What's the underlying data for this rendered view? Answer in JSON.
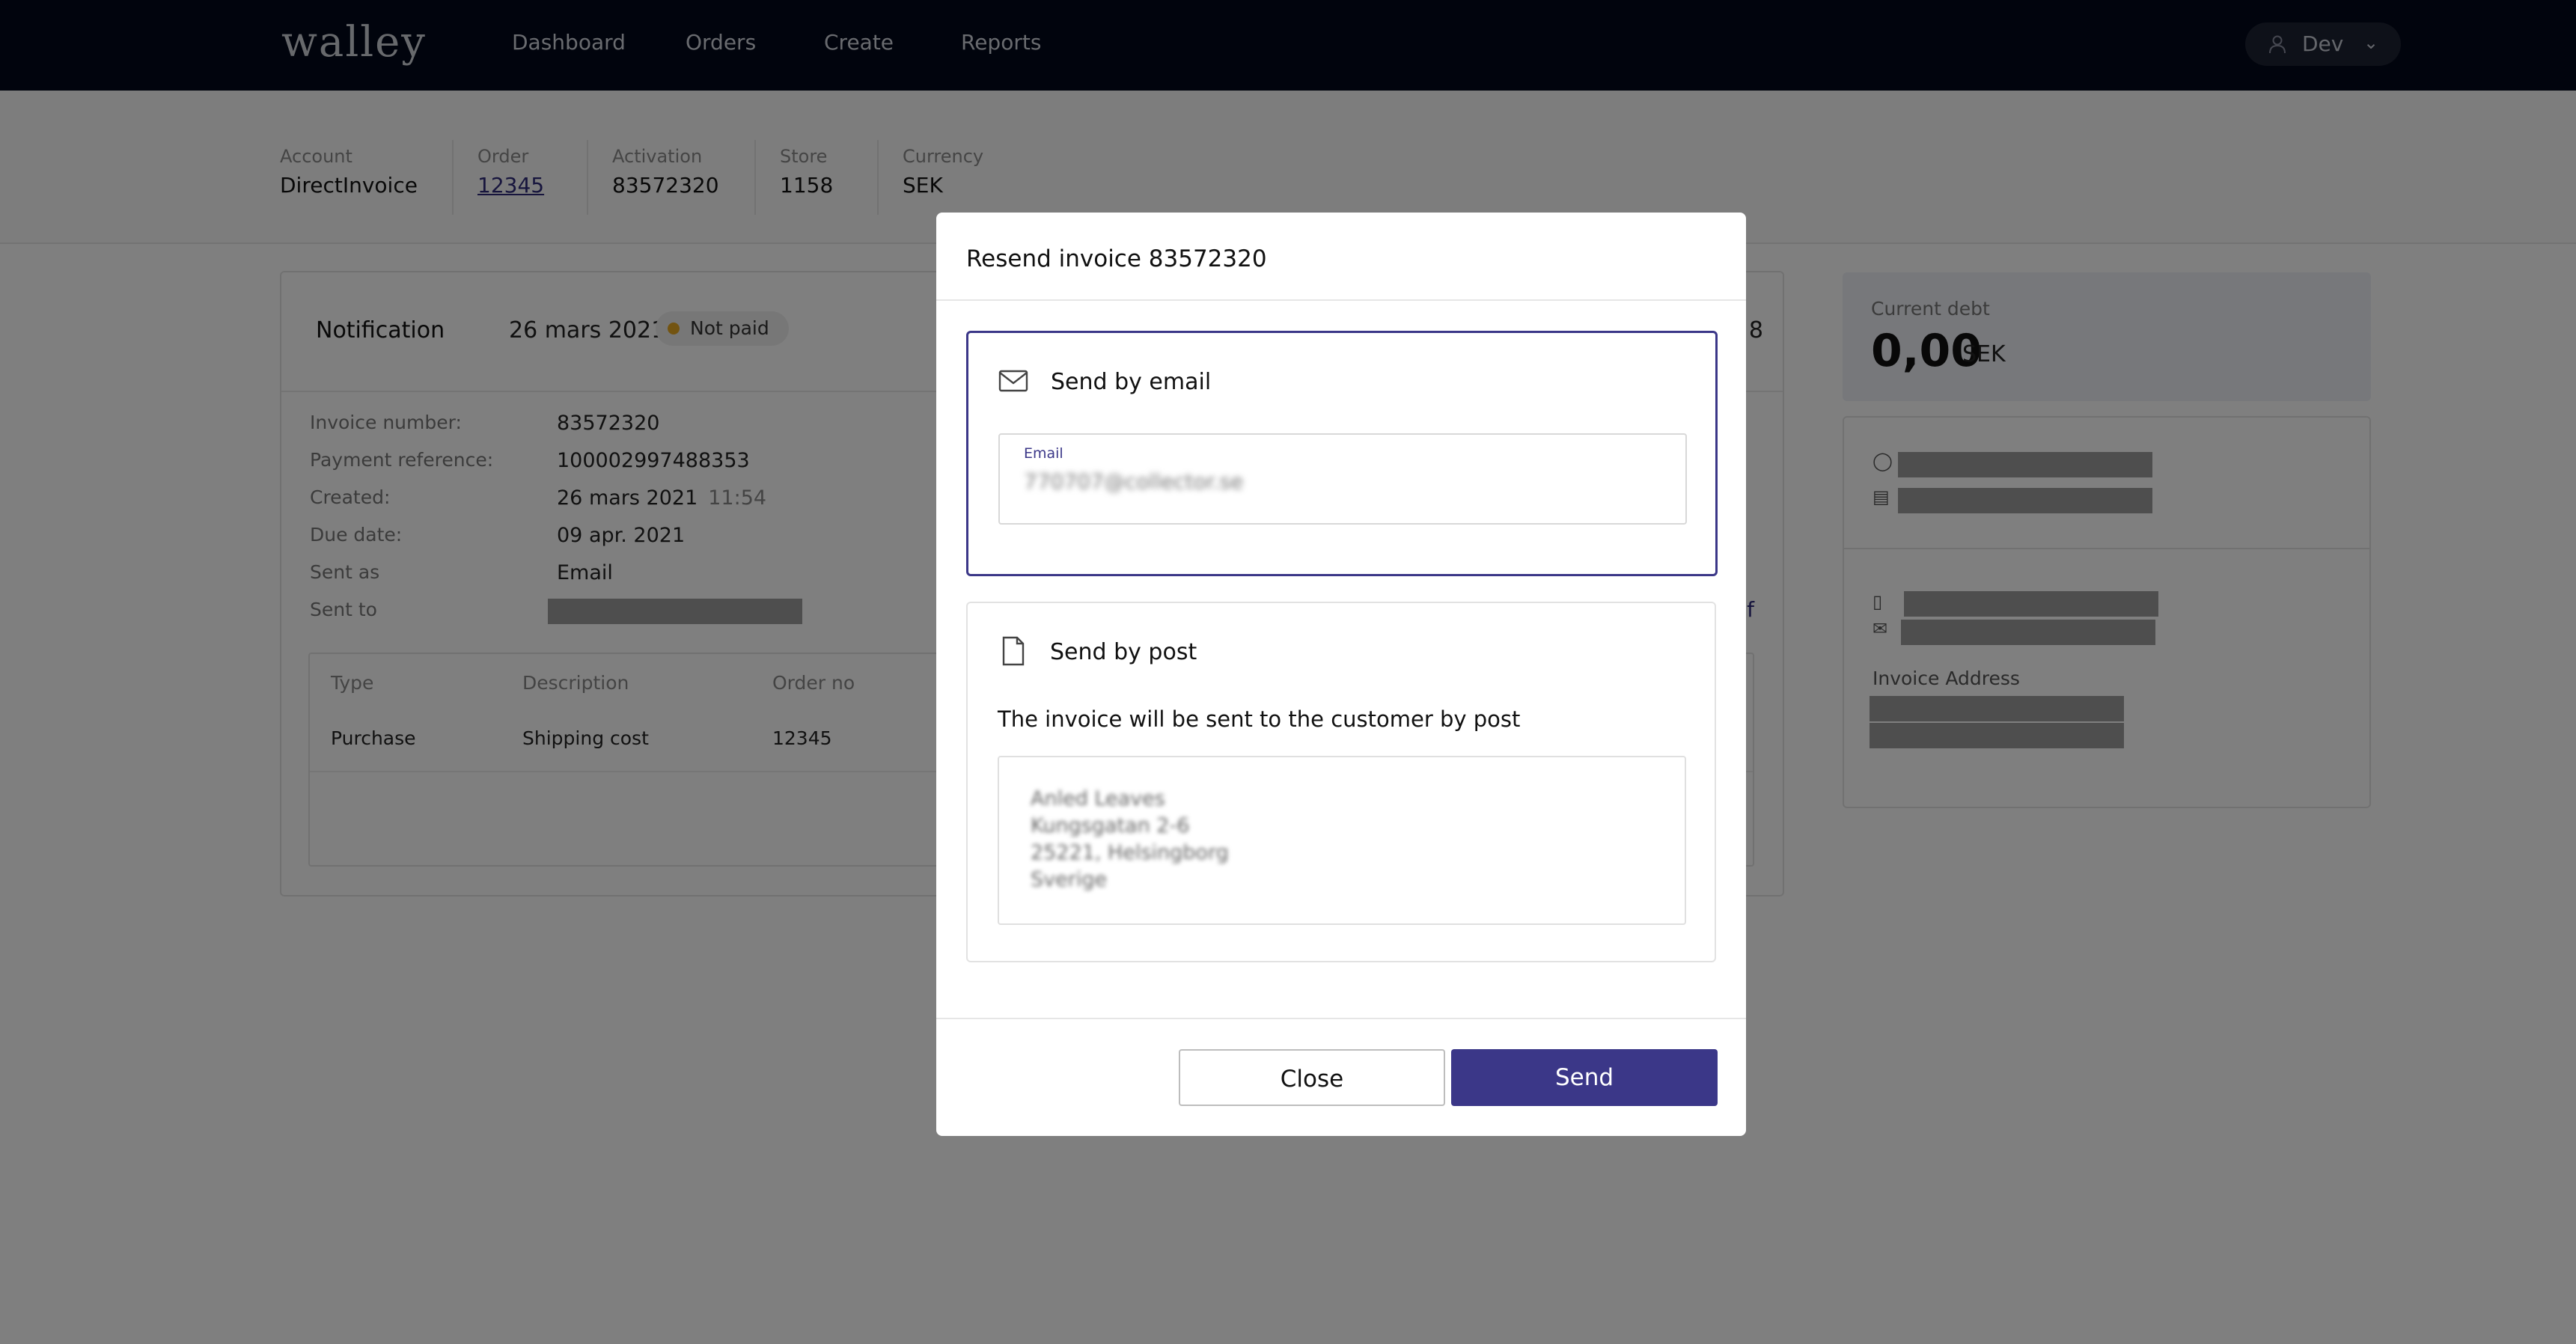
{
  "nav": {
    "logo": "walley",
    "links": [
      "Dashboard",
      "Orders",
      "Create",
      "Reports"
    ],
    "user": "Dev"
  },
  "summary": {
    "account": {
      "label": "Account",
      "value": "DirectInvoice"
    },
    "order": {
      "label": "Order",
      "value": "12345"
    },
    "activation": {
      "label": "Activation",
      "value": "83572320"
    },
    "store": {
      "label": "Store",
      "value": "1158"
    },
    "currency": {
      "label": "Currency",
      "value": "SEK"
    }
  },
  "notification": {
    "title": "Notification",
    "date": "26 mars 2021",
    "status": "Not paid",
    "partial_number": "8",
    "partial_link": "f",
    "details": {
      "invoice_number_label": "Invoice number:",
      "invoice_number": "83572320",
      "payment_reference_label": "Payment reference:",
      "payment_reference": "100002997488353",
      "created_label": "Created:",
      "created_date": "26 mars 2021",
      "created_time": "11:54",
      "due_date_label": "Due date:",
      "due_date": "09 apr. 2021",
      "sent_as_label": "Sent as",
      "sent_as": "Email",
      "sent_to_label": "Sent to"
    },
    "table": {
      "headers": [
        "Type",
        "Description",
        "Order no"
      ],
      "rows": [
        [
          "Purchase",
          "Shipping cost",
          "12345"
        ]
      ]
    }
  },
  "debt": {
    "label": "Current debt",
    "value": "0,00",
    "currency": "SEK"
  },
  "side": {
    "invoice_address_label": "Invoice Address"
  },
  "modal": {
    "title": "Resend invoice 83572320",
    "email_option": {
      "title": "Send by email",
      "field_label": "Email",
      "field_value": "770707@collector.se"
    },
    "post_option": {
      "title": "Send by post",
      "description": "The invoice will be sent to the customer by post",
      "address_lines": [
        "Anled Leaves",
        "Kungsgatan 2-6",
        "25221, Helsingborg",
        "Sverige"
      ]
    },
    "close_label": "Close",
    "send_label": "Send"
  },
  "colors": {
    "nav_bg": "#03081a",
    "accent": "#3b3788",
    "status_dot": "#e6a823",
    "debt_bg": "#eef0f6"
  }
}
